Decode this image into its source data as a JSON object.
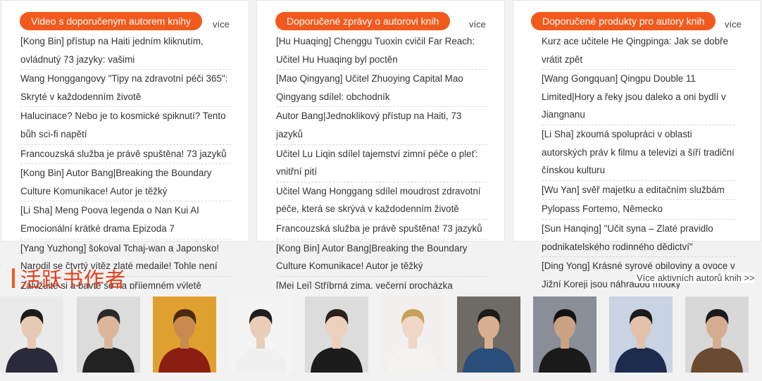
{
  "columns": [
    {
      "title": "Video s doporučeným autorem knihy",
      "more": "více",
      "items": [
        "[Kong Bin] přístup na Haiti jedním kliknutím, ovládnutý 73 jazyky: vašimi",
        "Wang Honggangovy \"Tipy na zdravotní péči 365\": Skryté v každodenním životě",
        "Halucinace? Nebo je to kosmické spiknutí? Tento bůh sci-fi napětí",
        "Francouzská služba je právě spuštěna! 73 jazyků",
        "[Kong Bin] Autor Bang|Breaking the Boundary Culture Komunikace! Autor je těžký",
        "[Li Sha] Meng Poova legenda o Nan Kui AI Emocionální krátké drama Epizoda 7",
        "[Yang Yuzhong] šokoval Tchaj-wan a Japonsko! Narodil se čtvrtý vítěz zlaté medaile! Tohle není",
        "Zalyžujte si a bavte se na příjemném výletě"
      ]
    },
    {
      "title": "Doporučené zprávy o autorovi knih",
      "more": "více",
      "items": [
        "[Hu Huaqing] Chenggu Tuoxin cvičil Far Reach: Učitel Hu Huaqing byl poctěn",
        "[Mao Qingyang] Učitel Zhuoying Capital Mao Qingyang sdílel: obchodník",
        "Autor Bang|Jednoklikový přístup na Haiti, 73 jazyků",
        "Učitel Lu Liqin sdílel tajemství zimní péče o pleť: vnitřní pití",
        "Učitel Wang Honggang sdílel moudrost zdravotní péče, která se skrývá v každodenním životě",
        "Francouzská služba je právě spuštěna! 73 jazyků",
        "[Kong Bin] Autor Bang|Breaking the Boundary Culture Komunikace! Autor je těžký",
        "[Mei Lei] Stříbrná zima, večerní procházka"
      ]
    },
    {
      "title": "Doporučené produkty pro autory knih",
      "more": "více",
      "items": [
        "Kurz ace učitele He Qingpinga: Jak se dobře vrátit zpět",
        "[Wang Gongquan] Qingpu Double 11 Limited|Hory a řeky jsou daleko a oni bydlí v Jiangnanu",
        "[Li Sha] zkoumá spolupráci v oblasti autorských práv k filmu a televizi a šíří tradiční čínskou kulturu",
        "[Wu Yan] svěř majetku a editačním službám",
        "Pylopass Fortemo, Německo",
        "[Sun Hanqing] \"Učit syna – Zlaté pravidlo podnikatelského rodinného dědictví\"",
        "[Ding Yong] Krásné syrové obiloviny a ovoce v Jižní Koreji jsou náhradou mouky"
      ]
    }
  ],
  "authors": {
    "title": "活跃书作者",
    "more": "Více aktivních autorů knih >>",
    "photos": [
      {
        "bg": "#eaeaea",
        "clothes": "#2b2a3a",
        "hair": "#1b1b1b",
        "skin": "#e8c9b4"
      },
      {
        "bg": "#dcdcdc",
        "clothes": "#222222",
        "hair": "#2a2a2a",
        "skin": "#dcb69a"
      },
      {
        "bg": "#e0a030",
        "clothes": "#8a1e12",
        "hair": "#4a2a10",
        "skin": "#c98a50"
      },
      {
        "bg": "#f4f4f4",
        "clothes": "#f0f0f0",
        "hair": "#1f1f1f",
        "skin": "#e9cdb8"
      },
      {
        "bg": "#dcdcdc",
        "clothes": "#1c1c1c",
        "hair": "#2b2018",
        "skin": "#ecd0bd"
      },
      {
        "bg": "#f2f0ee",
        "clothes": "#f5f3f0",
        "hair": "#c9a05a",
        "skin": "#f0d6c6"
      },
      {
        "bg": "#6e6a66",
        "clothes": "#2a4e7a",
        "hair": "#1c1c1c",
        "skin": "#d8b090"
      },
      {
        "bg": "#8a8e98",
        "clothes": "#1a1a1a",
        "hair": "#121212",
        "skin": "#caa384"
      },
      {
        "bg": "#c8d4e4",
        "clothes": "#1d2c4e",
        "hair": "#1a1a1a",
        "skin": "#e2c2aa"
      },
      {
        "bg": "#d8d8d8",
        "clothes": "#6a4a30",
        "hair": "#1a1a1a",
        "skin": "#d4ad90"
      }
    ]
  },
  "colors": {
    "accent": "#f25a1d",
    "title_red": "#e4401a"
  }
}
